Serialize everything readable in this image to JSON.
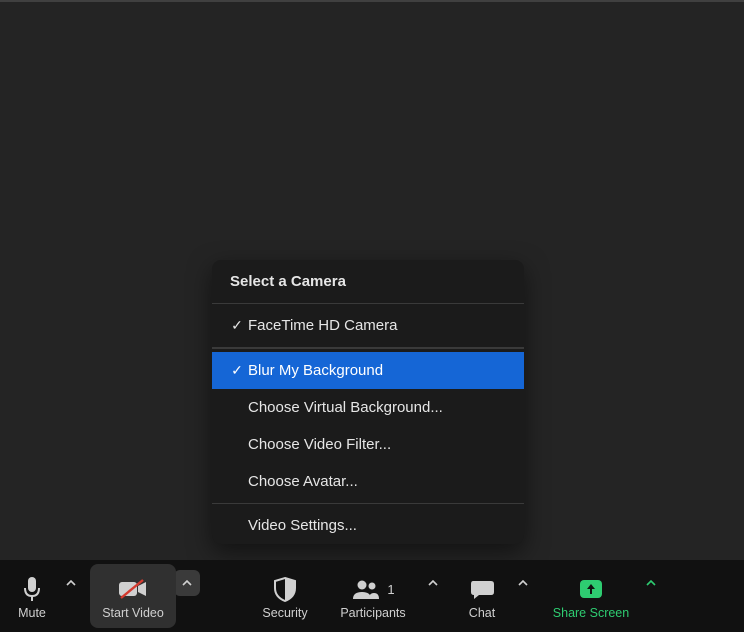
{
  "popup": {
    "header": "Select a Camera",
    "items": [
      {
        "label": "FaceTime HD Camera",
        "checked": true,
        "selected": false
      },
      {
        "label": "Blur My Background",
        "checked": true,
        "selected": true
      },
      {
        "label": "Choose Virtual Background...",
        "checked": false,
        "selected": false
      },
      {
        "label": "Choose Video Filter...",
        "checked": false,
        "selected": false
      },
      {
        "label": "Choose Avatar...",
        "checked": false,
        "selected": false
      },
      {
        "label": "Video Settings...",
        "checked": false,
        "selected": false
      }
    ]
  },
  "toolbar": {
    "mute_label": "Mute",
    "start_video_label": "Start Video",
    "security_label": "Security",
    "participants_label": "Participants",
    "participants_count": "1",
    "chat_label": "Chat",
    "share_screen_label": "Share Screen"
  },
  "colors": {
    "accent_green": "#2ecc71",
    "selection_blue": "#1566d6"
  }
}
